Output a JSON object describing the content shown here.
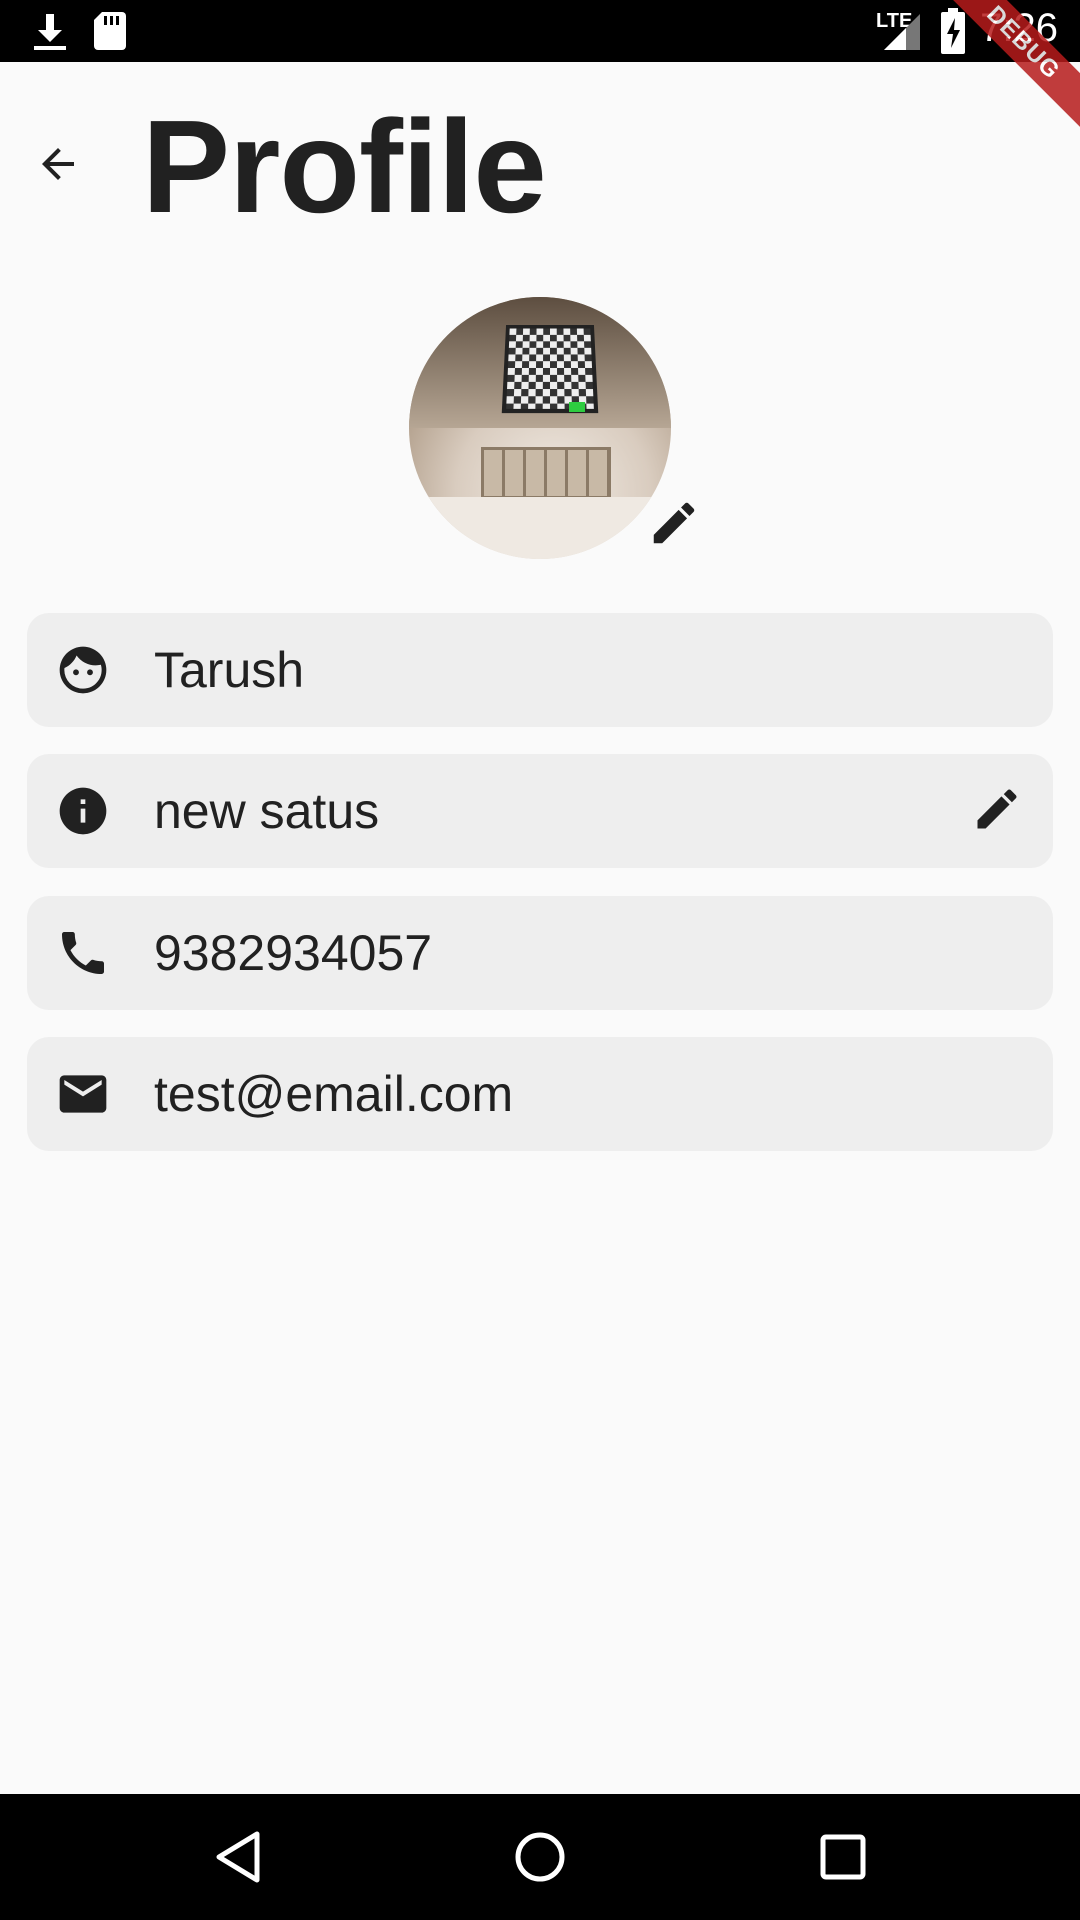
{
  "status_bar": {
    "time": "7:26",
    "network_label": "LTE",
    "icons": [
      "download-icon",
      "sd-card-icon",
      "signal-icon",
      "battery-charging-icon"
    ]
  },
  "debug_banner": "DEBUG",
  "header": {
    "title": "Profile",
    "back_icon": "arrow-back-icon"
  },
  "avatar": {
    "edit_icon": "pencil-icon"
  },
  "fields": [
    {
      "icon": "face-icon",
      "value": "Tarush",
      "editable": false
    },
    {
      "icon": "info-icon",
      "value": "new satus",
      "editable": true
    },
    {
      "icon": "phone-icon",
      "value": "9382934057",
      "editable": false
    },
    {
      "icon": "email-icon",
      "value": "test@email.com",
      "editable": false
    }
  ],
  "nav_bar": {
    "icons": [
      "back-triangle-icon",
      "home-circle-icon",
      "recents-square-icon"
    ]
  },
  "colors": {
    "background": "#fafafa",
    "field_background": "#eeeeee",
    "text": "#212121",
    "system_bars": "#000000",
    "debug_ribbon": "#b71c1c"
  }
}
